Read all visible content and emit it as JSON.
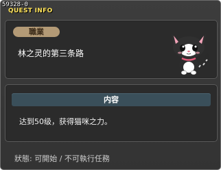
{
  "window": {
    "quest_id": "59328-0",
    "title": "QUEST INFO"
  },
  "quest": {
    "job_label": "職業",
    "name": "林之灵的第三条路",
    "npc_icon": "black-white-cat-icon"
  },
  "content": {
    "header": "内容",
    "text": "达到50级，获得猫咪之力。"
  },
  "status": {
    "label": "狀態:",
    "value": "可開始 / 不可執行任務"
  },
  "colors": {
    "title": "#ffe35a",
    "badge_bg": "#b39a76",
    "content_header_bg": "#3a4f5a",
    "window_bg": "#383838"
  }
}
